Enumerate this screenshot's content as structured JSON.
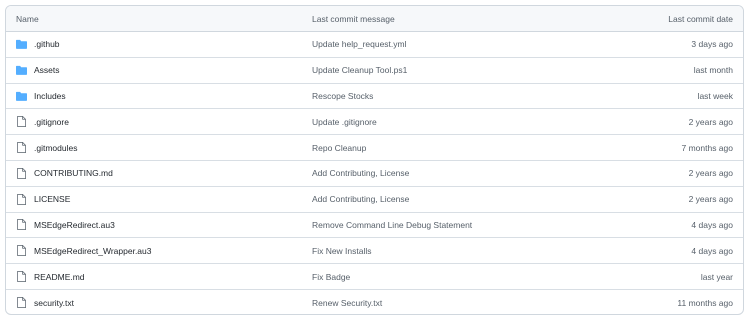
{
  "table": {
    "headers": {
      "name": "Name",
      "message": "Last commit message",
      "date": "Last commit date"
    },
    "rows": [
      {
        "type": "folder",
        "name": ".github",
        "message": "Update help_request.yml",
        "date": "3 days ago"
      },
      {
        "type": "folder",
        "name": "Assets",
        "message": "Update Cleanup Tool.ps1",
        "date": "last month"
      },
      {
        "type": "folder",
        "name": "Includes",
        "message": "Rescope Stocks",
        "date": "last week"
      },
      {
        "type": "file",
        "name": ".gitignore",
        "message": "Update .gitignore",
        "date": "2 years ago"
      },
      {
        "type": "file",
        "name": ".gitmodules",
        "message": "Repo Cleanup",
        "date": "7 months ago"
      },
      {
        "type": "file",
        "name": "CONTRIBUTING.md",
        "message": "Add Contributing, License",
        "date": "2 years ago"
      },
      {
        "type": "file",
        "name": "LICENSE",
        "message": "Add Contributing, License",
        "date": "2 years ago"
      },
      {
        "type": "file",
        "name": "MSEdgeRedirect.au3",
        "message": "Remove Command Line Debug Statement",
        "date": "4 days ago"
      },
      {
        "type": "file",
        "name": "MSEdgeRedirect_Wrapper.au3",
        "message": "Fix New Installs",
        "date": "4 days ago"
      },
      {
        "type": "file",
        "name": "README.md",
        "message": "Fix Badge",
        "date": "last year"
      },
      {
        "type": "file",
        "name": "security.txt",
        "message": "Renew Security.txt",
        "date": "11 months ago"
      }
    ]
  },
  "colors": {
    "folder_icon": "#54aeff",
    "file_icon": "#57606a",
    "border": "#d0d7de",
    "header_bg": "#f6f8fa"
  }
}
